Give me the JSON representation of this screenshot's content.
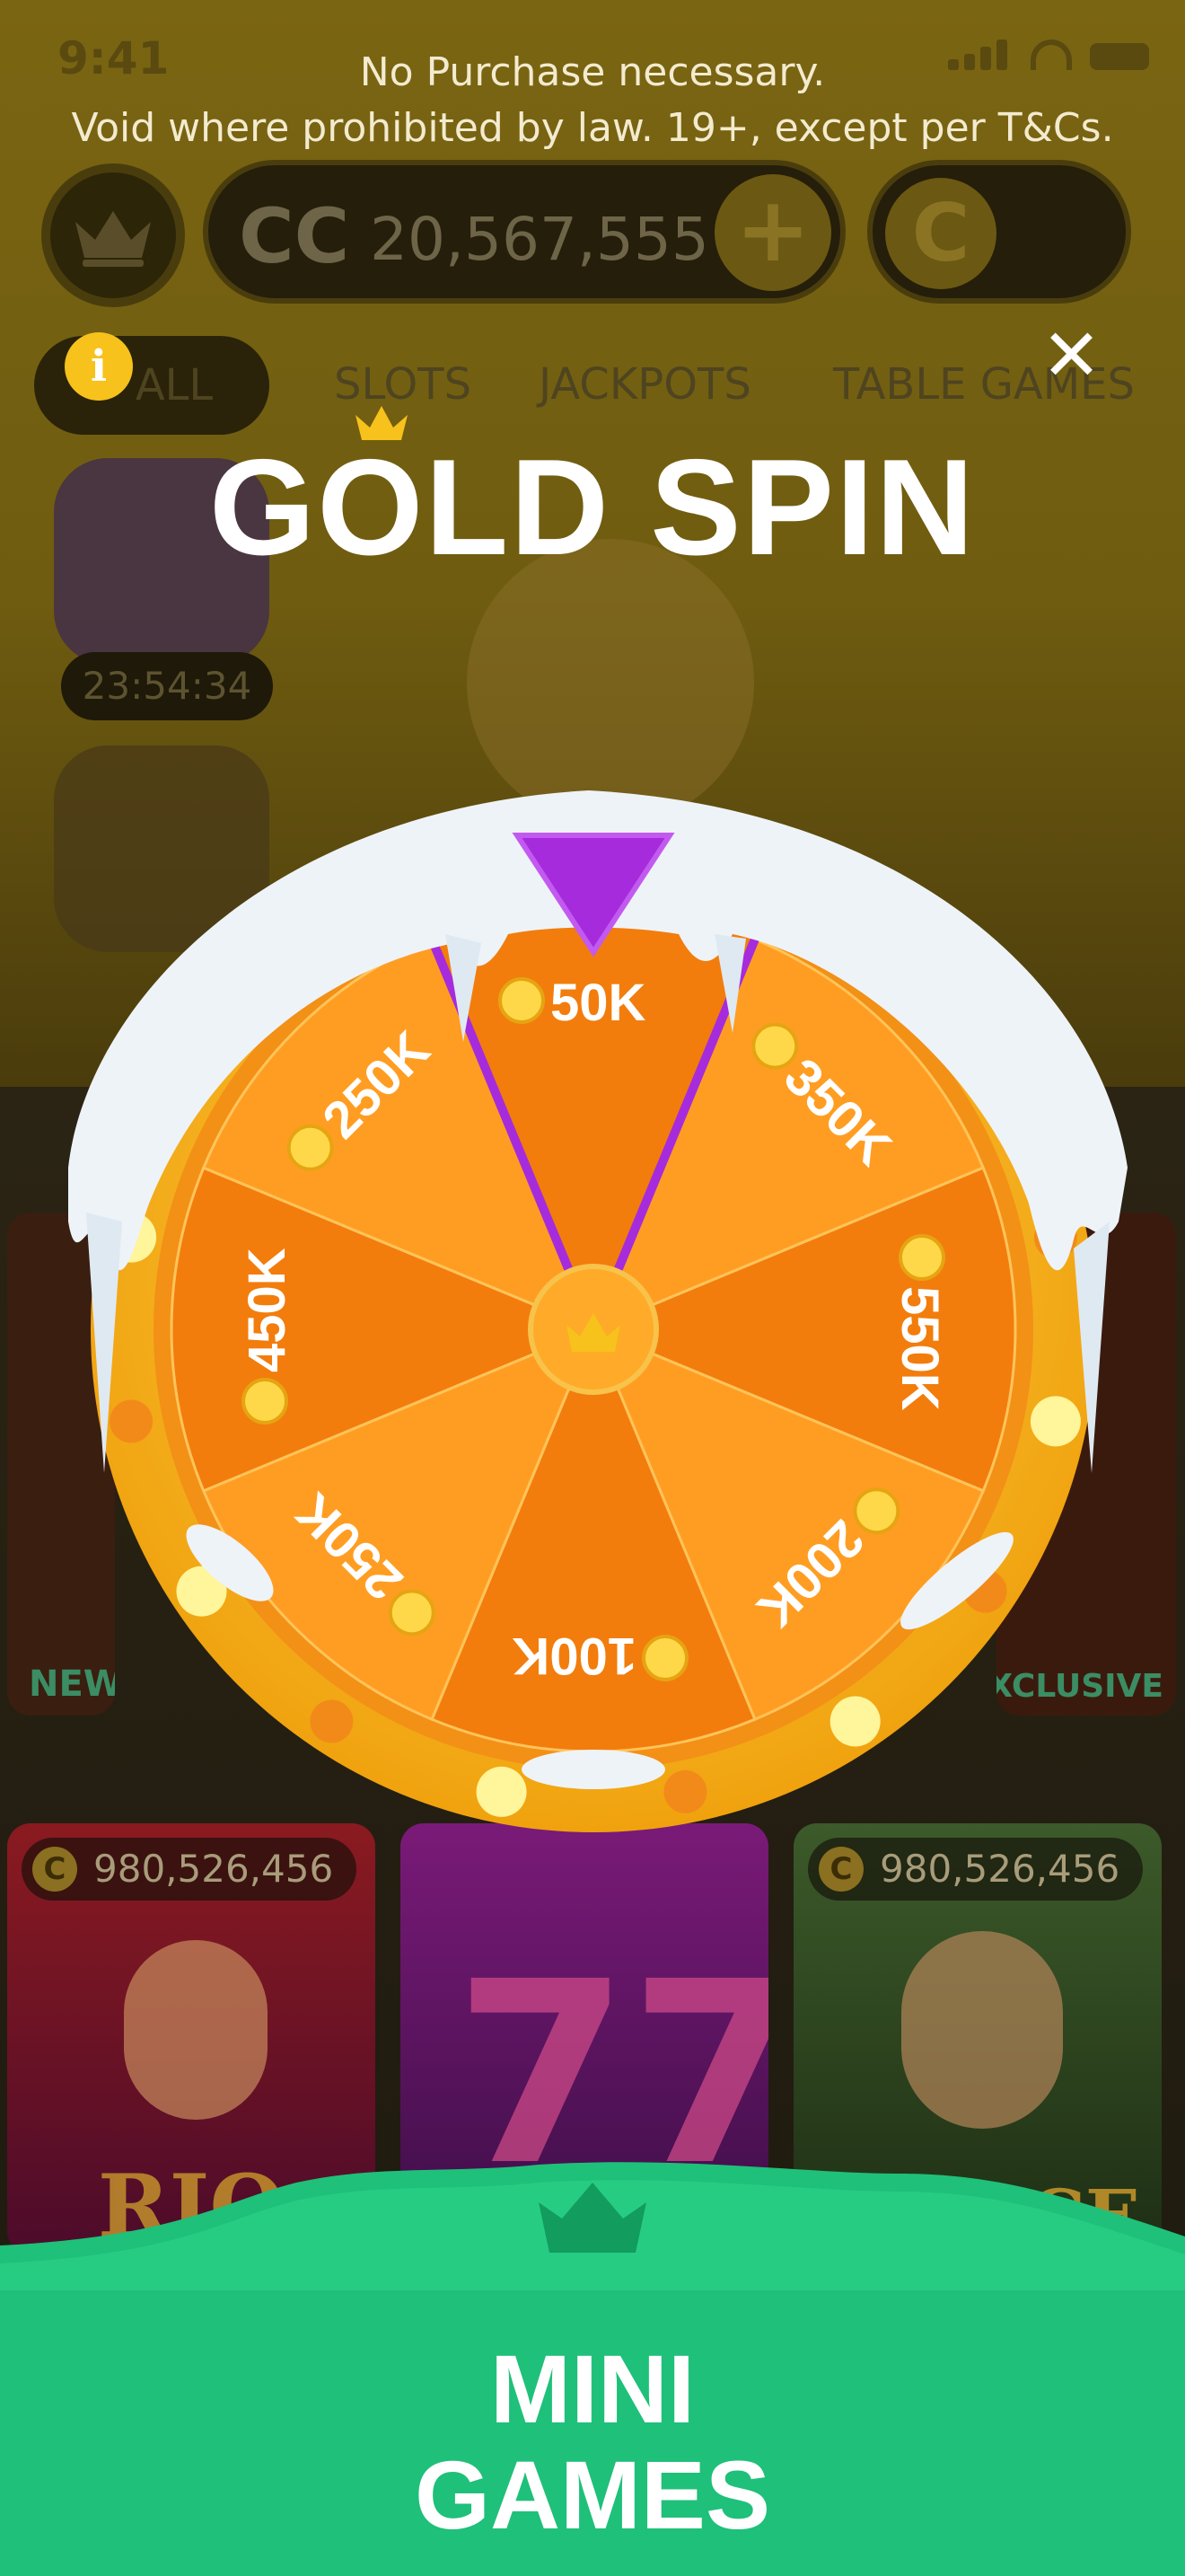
{
  "status": {
    "time": "9:41"
  },
  "disclaimer": {
    "line1": "No Purchase necessary.",
    "line2": "Void where prohibited by law. 19+, except per T&Cs."
  },
  "wallet": {
    "cc_label": "CC",
    "cc_value": "20,567,555",
    "plus_label": "+",
    "c_label": "C"
  },
  "tabs": [
    {
      "label": "ALL",
      "active": true
    },
    {
      "label": "SLOTS"
    },
    {
      "label": "JACKPOTS"
    },
    {
      "label": "TABLE GAMES"
    }
  ],
  "info_icon_label": "i",
  "close_label": "✕",
  "title": "GOLD SPIN",
  "promo": {
    "timer": "23:54:34"
  },
  "wheel": {
    "segments": [
      {
        "label": "50K"
      },
      {
        "label": "350K"
      },
      {
        "label": "550K"
      },
      {
        "label": "200K"
      },
      {
        "label": "100K"
      },
      {
        "label": "250K"
      },
      {
        "label": "450K"
      },
      {
        "label": "250K"
      }
    ],
    "colors": {
      "rim": "#f6b51f",
      "light": "#ff9d22",
      "dark": "#f27d0c",
      "pointer": "#a52bdc",
      "snow": "#eef3f8"
    }
  },
  "games": [
    {
      "count": "980,526,456",
      "name": "RIO"
    },
    {
      "count": "",
      "name": ""
    },
    {
      "count": "980,526,456",
      "name": "PRINCE"
    }
  ],
  "badges": {
    "left": "NEW",
    "right": "EXCLUSIVE"
  },
  "banner": {
    "line1": "MINI",
    "line2": "GAMES",
    "color": "#1fc07a"
  }
}
